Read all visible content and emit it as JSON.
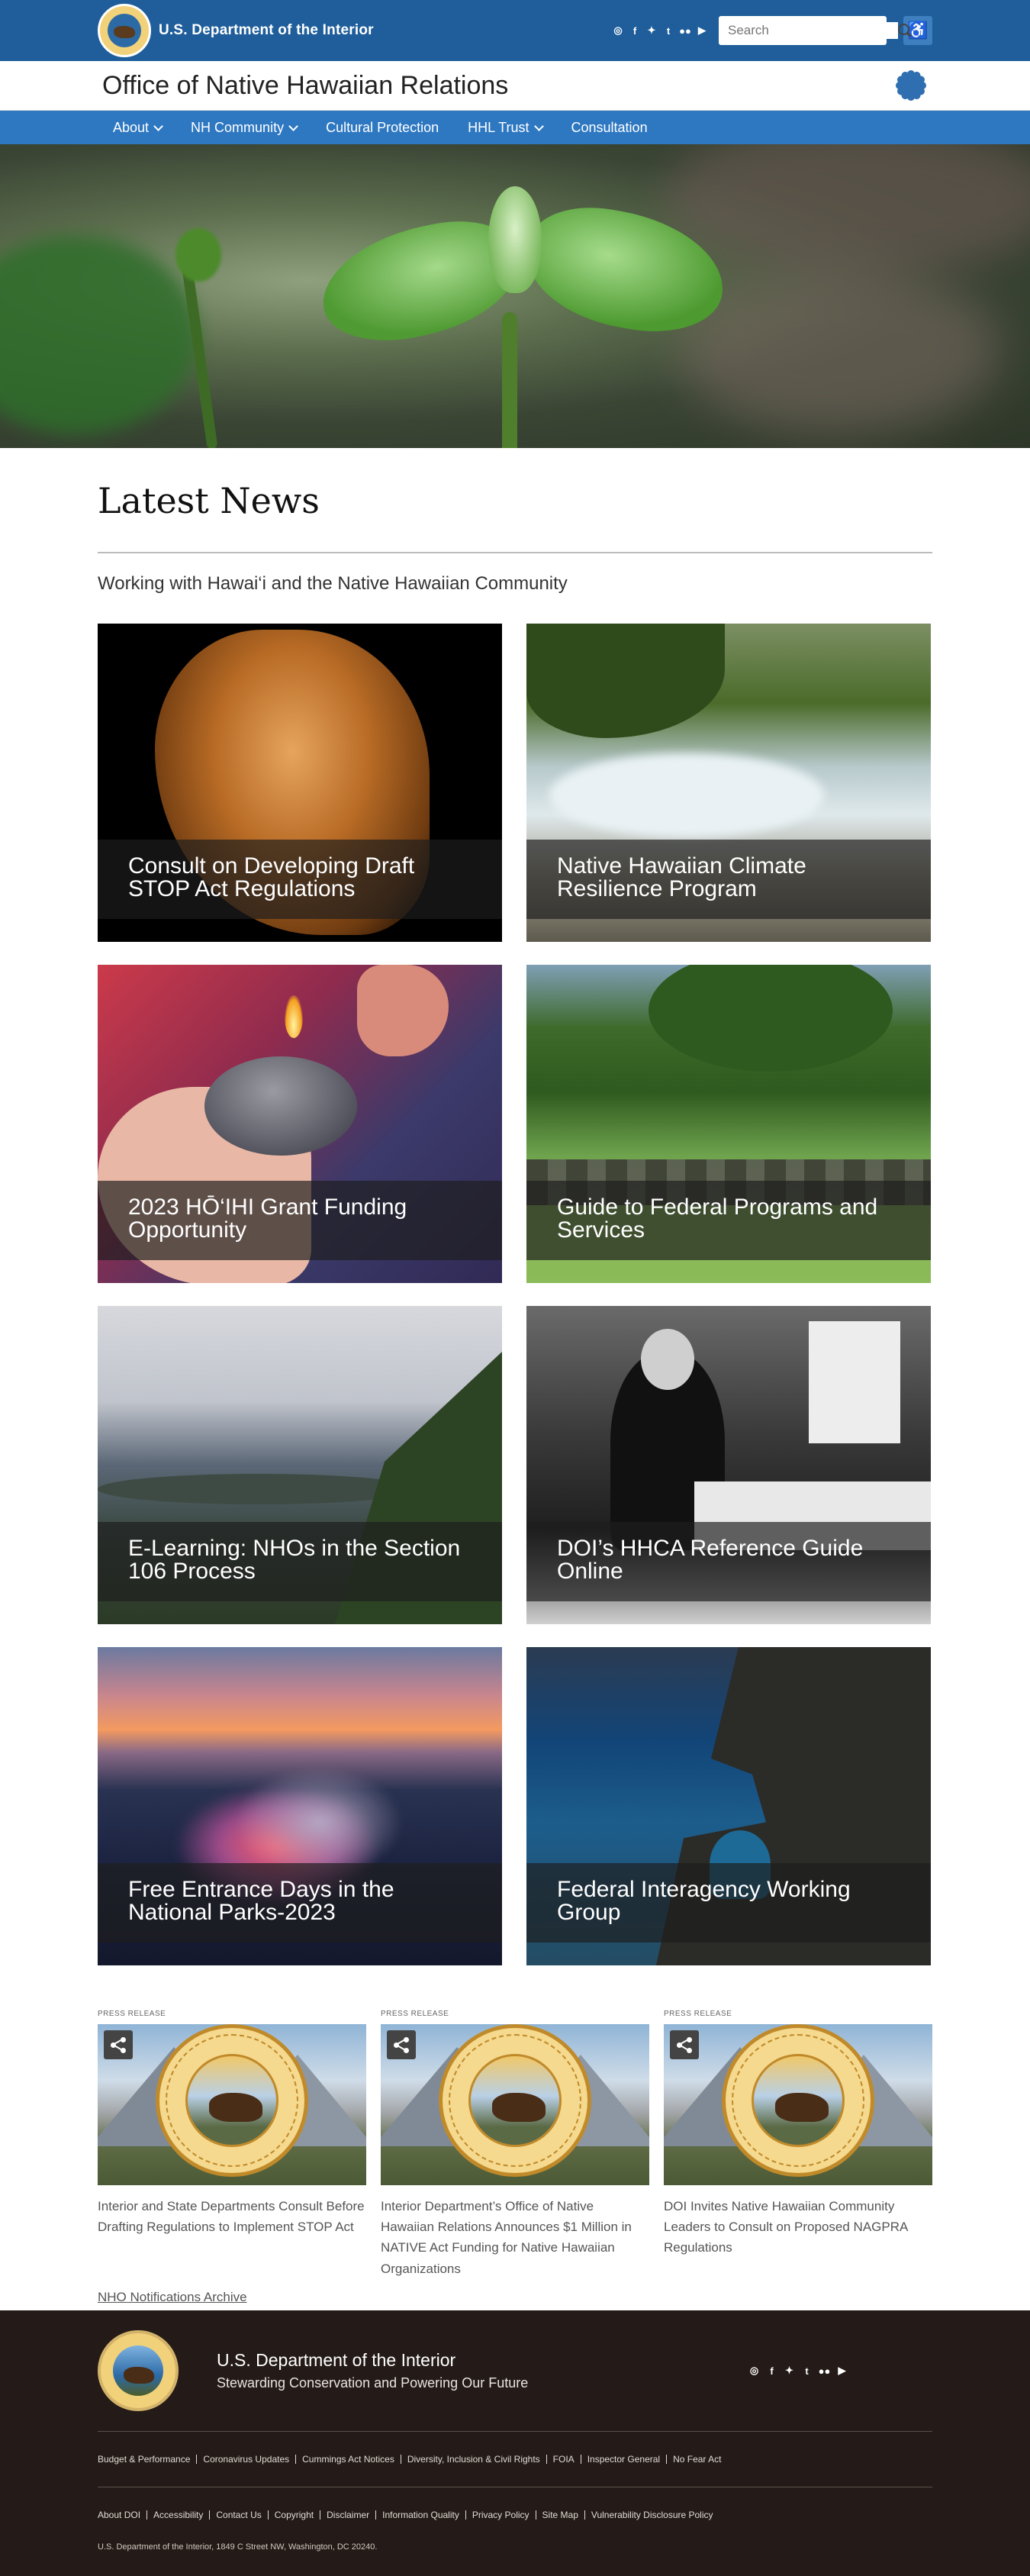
{
  "header": {
    "brand": "U.S. Department of the Interior",
    "social": [
      "instagram-icon",
      "facebook-icon",
      "twitter-icon",
      "tumblr-icon",
      "flickr-icon",
      "youtube-icon"
    ],
    "search_placeholder": "Search",
    "accessibility_label": "♿"
  },
  "office": {
    "title": "Office of Native Hawaiian Relations"
  },
  "nav": {
    "items": [
      {
        "label": "About",
        "dropdown": true
      },
      {
        "label": "NH Community",
        "dropdown": true
      },
      {
        "label": "Cultural Protection",
        "dropdown": false
      },
      {
        "label": "HHL Trust",
        "dropdown": true
      },
      {
        "label": "Consultation",
        "dropdown": false
      }
    ]
  },
  "latest": {
    "heading": "Latest News",
    "subtitle": "Working with Hawai‘i and the Native Hawaiian Community",
    "cards": [
      {
        "title": "Consult on Developing Draft STOP Act Regulations",
        "image": "shell"
      },
      {
        "title": "Native Hawaiian Climate Resilience Program",
        "image": "flood"
      },
      {
        "title": "2023 HŌ‘IHI Grant Funding Opportunity",
        "image": "stone"
      },
      {
        "title": "Guide to Federal Programs and Services",
        "image": "taro"
      },
      {
        "title": "E-Learning: NHOs in the Section 106 Process",
        "image": "coast"
      },
      {
        "title": "DOI’s HHCA Reference Guide Online",
        "image": "office"
      },
      {
        "title": "Free Entrance Days in the National Parks-2023",
        "image": "volcano"
      },
      {
        "title": "Federal Interagency Working Group",
        "image": "arch"
      }
    ]
  },
  "press": {
    "tag": "PRESS RELEASE",
    "items": [
      {
        "title": "Interior and State Departments Consult Before Drafting Regulations to Implement STOP Act"
      },
      {
        "title": "Interior Department’s Office of Native Hawaiian Relations Announces $1 Million in NATIVE Act Funding for Native Hawaiian Organizations"
      },
      {
        "title": "DOI Invites Native Hawaiian Community Leaders to Consult on Proposed NAGPRA Regulations"
      }
    ],
    "archive": "NHO Notifications Archive"
  },
  "footer": {
    "title": "U.S. Department of the Interior",
    "subtitle": "Stewarding Conservation and Powering Our Future",
    "links1": [
      "Budget & Performance",
      "Coronavirus Updates",
      "Cummings Act Notices",
      "Diversity, Inclusion & Civil Rights",
      "FOIA",
      "Inspector General",
      "No Fear Act"
    ],
    "links2": [
      "About DOI",
      "Accessibility",
      "Contact Us",
      "Copyright",
      "Disclaimer",
      "Information Quality",
      "Privacy Policy",
      "Site Map",
      "Vulnerability Disclosure Policy"
    ],
    "copyright": "U.S. Department of the Interior, 1849 C Street NW, Washington, DC 20240."
  }
}
